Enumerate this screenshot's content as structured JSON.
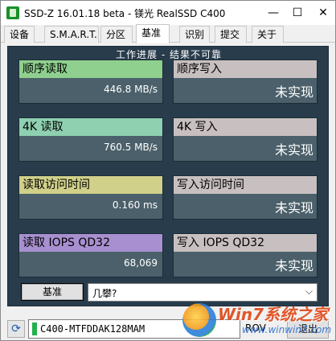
{
  "window": {
    "title": "SSD-Z 16.01.18 beta - 镁光 RealSSD C400",
    "min_glyph": "—",
    "max_glyph": "☐",
    "close_glyph": "✕"
  },
  "tabs": [
    {
      "label": "设备"
    },
    {
      "label": "S.M.A.R.T."
    },
    {
      "label": "分区"
    },
    {
      "label": "基准",
      "active": true
    },
    {
      "label": "识别"
    },
    {
      "label": "提交"
    },
    {
      "label": "关于"
    }
  ],
  "panel": {
    "status": "工作进展 - 结果不可靠"
  },
  "cards": [
    {
      "header": "顺序读取",
      "header_color": "#8fd08f",
      "value": "446.8 MB/s"
    },
    {
      "header": "顺序写入",
      "header_color": "#c8c0c0",
      "value": "未实现"
    },
    {
      "header": "4K 读取",
      "header_color": "#8fd0b0",
      "value": "760.5 MB/s"
    },
    {
      "header": "4K 写入",
      "header_color": "#c8c0c0",
      "value": "未实现"
    },
    {
      "header": "读取访问时间",
      "header_color": "#d0d08a",
      "value": "0.160 ms"
    },
    {
      "header": "写入访问时间",
      "header_color": "#c8c0c0",
      "value": "未实现"
    },
    {
      "header": "读取 IOPS QD32",
      "header_color": "#a890d0",
      "value": "68,069"
    },
    {
      "header": "写入 IOPS QD32",
      "header_color": "#c8c0c0",
      "value": "未实现"
    }
  ],
  "controls": {
    "benchmark_button": "基准",
    "combo_value": "几攀?",
    "combo_arrow": "⌵"
  },
  "bottom": {
    "refresh_glyph": "⟳",
    "drive_name": "C400-MTFDDAK128MAM",
    "rows_label": "ROV",
    "exit_label": "退出"
  },
  "watermark": {
    "brand": "Win7系统之家",
    "url": "www.winwin7.com"
  }
}
